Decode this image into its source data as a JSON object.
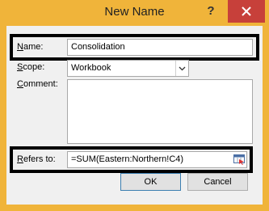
{
  "dialog": {
    "title": "New Name",
    "help_label": "?",
    "close_icon": "close-icon"
  },
  "form": {
    "name_label_prefix": "N",
    "name_label_rest": "ame:",
    "name_value": "Consolidation",
    "scope_label_prefix": "S",
    "scope_label_rest": "cope:",
    "scope_value": "Workbook",
    "comment_label_prefix": "C",
    "comment_label_rest": "omment:",
    "comment_value": "",
    "refers_label_prefix": "R",
    "refers_label_rest": "efers to:",
    "refers_value": "=SUM(Eastern:Northern!C4)"
  },
  "buttons": {
    "ok_label": "OK",
    "cancel_label": "Cancel"
  },
  "colors": {
    "frame": "#f0b43a",
    "close_bg": "#c7403a",
    "highlight": "#000000"
  }
}
